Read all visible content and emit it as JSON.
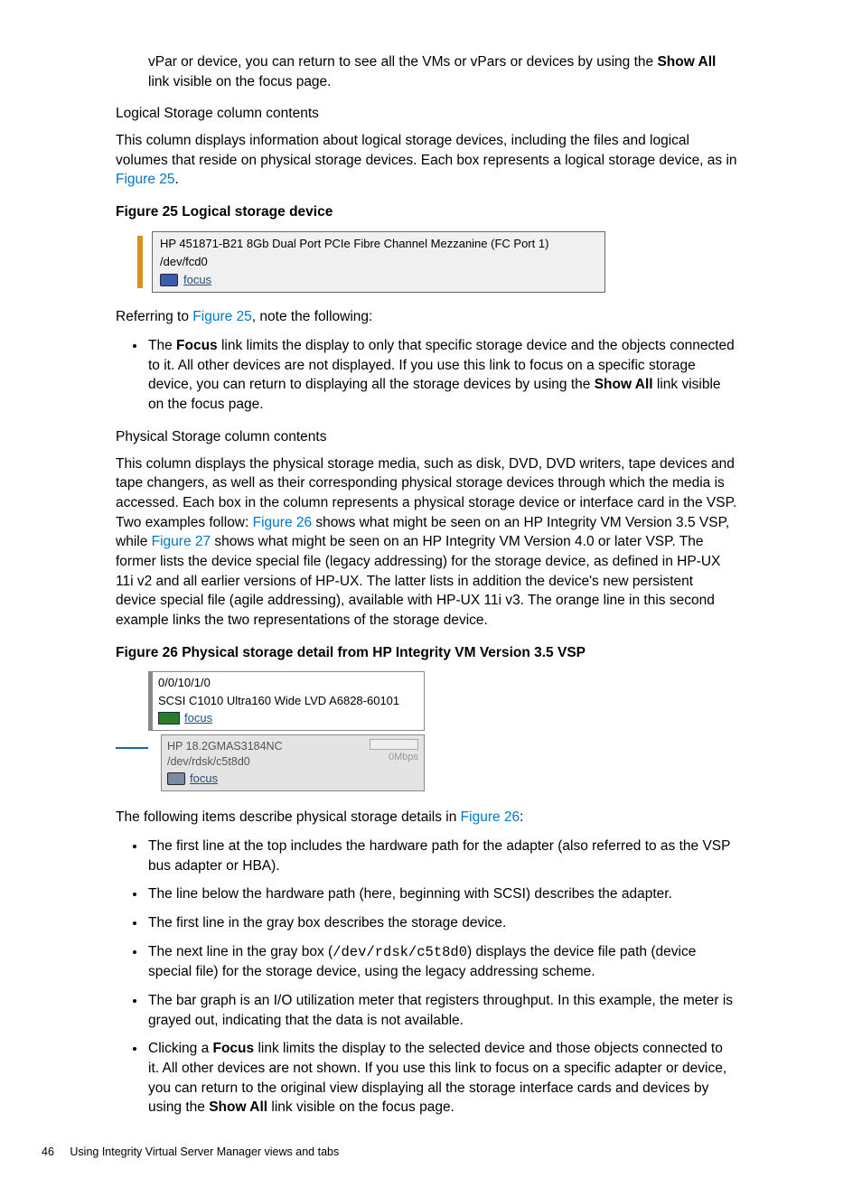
{
  "intro": {
    "line_a": "vPar or device, you can return to see all the VMs or vPars or devices by using the ",
    "line_b": "Show All",
    "line_c": " link visible on the focus page."
  },
  "logical": {
    "heading": "Logical Storage column contents",
    "para_a": "This column displays information about logical storage devices, including the files and logical volumes that reside on physical storage devices. Each box represents a logical storage device, as in ",
    "para_link": "Figure 25",
    "para_end": "."
  },
  "fig25": {
    "title": "Figure 25 Logical storage device",
    "line1": "HP 451871-B21 8Gb Dual Port PCIe Fibre Channel Mezzanine (FC Port 1)",
    "line2": "/dev/fcd0",
    "focus": "focus"
  },
  "ref25": {
    "a": "Referring to ",
    "link": "Figure 25",
    "b": ", note the following:"
  },
  "bullets25": [
    {
      "pre": "The ",
      "bold1": "Focus",
      "mid": " link limits the display to only that specific storage device and the objects connected to it. All other devices are not displayed. If you use this link to focus on a specific storage device, you can return to displaying all the storage devices by using the ",
      "bold2": "Show All",
      "end": " link visible on the focus page."
    }
  ],
  "physical": {
    "heading": "Physical Storage column contents",
    "p1a": "This column displays the physical storage media, such as disk, DVD, DVD writers, tape devices and tape changers, as well as their corresponding physical storage devices through which the media is accessed. Each box in the column represents a physical storage device or interface card in the VSP. Two examples follow: ",
    "p1l1": "Figure 26",
    "p1b": " shows what might be seen on an HP Integrity VM Version 3.5 VSP, while ",
    "p1l2": "Figure 27",
    "p1c": " shows what might be seen on an HP Integrity VM Version 4.0 or later VSP. The former lists the device special file (legacy addressing) for the storage device, as defined in HP-UX 11i v2 and all earlier versions of HP-UX. The latter lists in addition the device's new persistent device special file (agile addressing), available with HP-UX 11i v3. The orange line in this second example links the two representations of the storage device."
  },
  "fig26": {
    "title": "Figure 26 Physical storage detail from HP Integrity VM Version 3.5 VSP",
    "hwpath": "0/0/10/1/0",
    "adapter": "SCSI C1010 Ultra160 Wide LVD A6828-60101",
    "focus1": "focus",
    "dev": "HP 18.2GMAS3184NC",
    "devfile": "/dev/rdsk/c5t8d0",
    "focus2": "focus",
    "mbps": "0Mbps"
  },
  "ref26": {
    "a": "The following items describe physical storage details in ",
    "link": "Figure 26",
    "b": ":"
  },
  "bullets26": {
    "b1": "The first line at the top includes the hardware path for the adapter (also referred to as the VSP bus adapter or HBA).",
    "b2": "The line below the hardware path (here, beginning with SCSI) describes the adapter.",
    "b3": "The first line in the gray box describes the storage device.",
    "b4a": "The next line in the gray box (",
    "b4code": "/dev/rdsk/c5t8d0",
    "b4b": ") displays the device file path (device special file) for the storage device, using the legacy addressing scheme.",
    "b5": "The bar graph is an I/O utilization meter that registers throughput. In this example, the meter is grayed out, indicating that the data is not available.",
    "b6a": "Clicking a ",
    "b6bold1": "Focus",
    "b6b": " link limits the display to the selected device and those objects connected to it. All other devices are not shown. If you use this link to focus on a specific adapter or device, you can return to the original view displaying all the storage interface cards and devices by using the ",
    "b6bold2": "Show All",
    "b6c": " link visible on the focus page."
  },
  "footer": {
    "num": "46",
    "text": "Using Integrity Virtual Server Manager views and tabs"
  }
}
